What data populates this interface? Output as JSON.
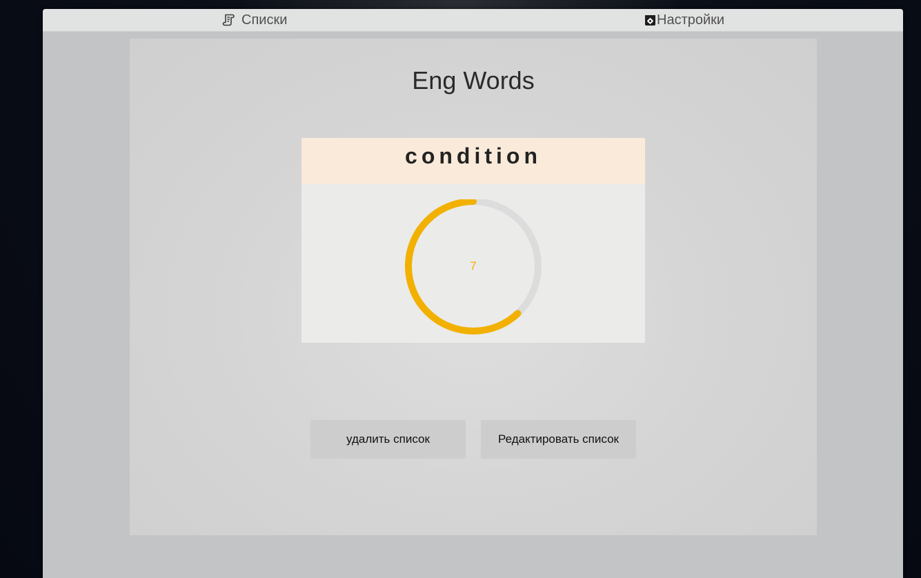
{
  "nav": {
    "lists_label": "Списки",
    "settings_label": "Настройки"
  },
  "page": {
    "title": "Eng Words"
  },
  "card": {
    "word": "condition",
    "progress_value": "7",
    "progress_fraction": 0.62,
    "colors": {
      "progress": "#f2b100",
      "track": "#dcdcdc",
      "header_bg": "#faead9"
    }
  },
  "actions": {
    "delete_label": "удалить список",
    "edit_label": "Редактировать список"
  },
  "icons": {
    "lists": "scroll-icon",
    "settings": "settings-box-icon"
  }
}
